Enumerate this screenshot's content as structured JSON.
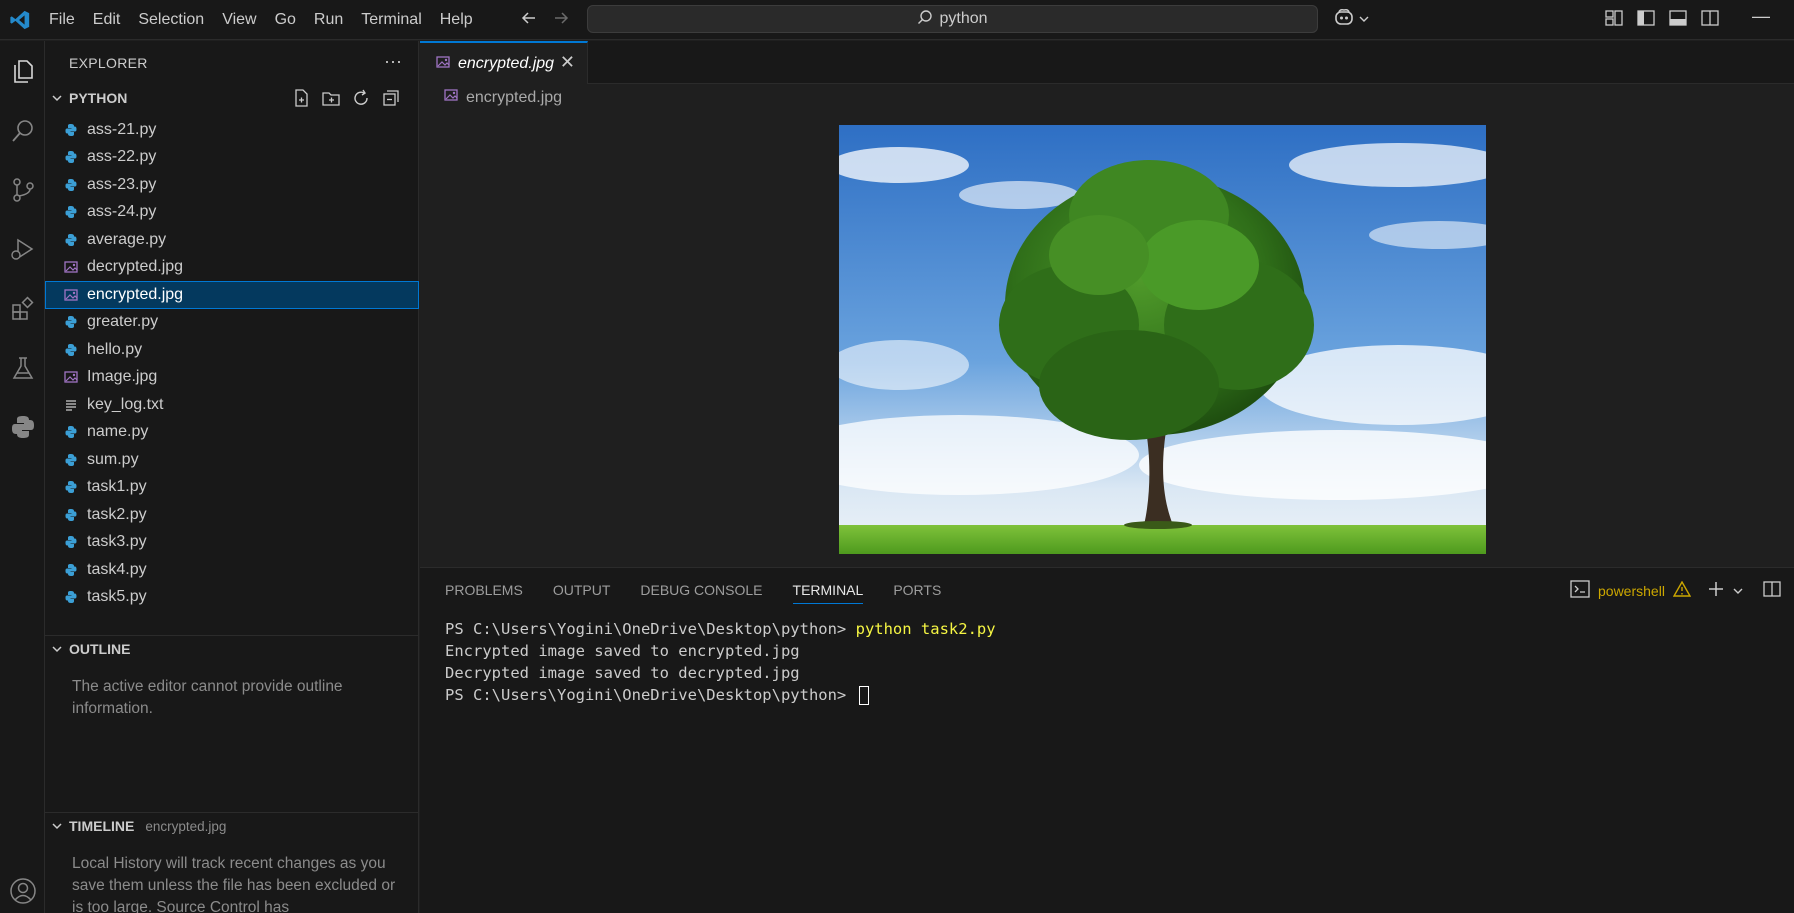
{
  "menu": [
    "File",
    "Edit",
    "Selection",
    "View",
    "Go",
    "Run",
    "Terminal",
    "Help"
  ],
  "search": {
    "value": "python"
  },
  "explorer": {
    "title": "EXPLORER",
    "folder": "PYTHON",
    "files": [
      {
        "name": "ass-21.py",
        "type": "python"
      },
      {
        "name": "ass-22.py",
        "type": "python"
      },
      {
        "name": "ass-23.py",
        "type": "python"
      },
      {
        "name": "ass-24.py",
        "type": "python"
      },
      {
        "name": "average.py",
        "type": "python"
      },
      {
        "name": "decrypted.jpg",
        "type": "image"
      },
      {
        "name": "encrypted.jpg",
        "type": "image",
        "selected": true
      },
      {
        "name": "greater.py",
        "type": "python"
      },
      {
        "name": "hello.py",
        "type": "python"
      },
      {
        "name": "Image.jpg",
        "type": "image"
      },
      {
        "name": "key_log.txt",
        "type": "text"
      },
      {
        "name": "name.py",
        "type": "python"
      },
      {
        "name": "sum.py",
        "type": "python"
      },
      {
        "name": "task1.py",
        "type": "python"
      },
      {
        "name": "task2.py",
        "type": "python"
      },
      {
        "name": "task3.py",
        "type": "python"
      },
      {
        "name": "task4.py",
        "type": "python"
      },
      {
        "name": "task5.py",
        "type": "python"
      }
    ]
  },
  "outline": {
    "title": "OUTLINE",
    "message": "The active editor cannot provide outline information."
  },
  "timeline": {
    "title": "TIMELINE",
    "file": "encrypted.jpg",
    "message": "Local History will track recent changes as you save them unless the file has been excluded or is too large. Source Control has"
  },
  "editor": {
    "tab_label": "encrypted.jpg",
    "breadcrumb": "encrypted.jpg"
  },
  "panel": {
    "tabs": [
      "PROBLEMS",
      "OUTPUT",
      "DEBUG CONSOLE",
      "TERMINAL",
      "PORTS"
    ],
    "active_tab": "TERMINAL",
    "shell": "powershell",
    "terminal": {
      "prompt": "PS C:\\Users\\Yogini\\OneDrive\\Desktop\\python> ",
      "command": "python task2.py",
      "output_1": "Encrypted image saved to encrypted.jpg",
      "output_2": "Decrypted image saved to decrypted.jpg"
    }
  },
  "colors": {
    "accent": "#0078d4",
    "python_icon": "#3b9fd6",
    "image_icon": "#a074c4",
    "warning": "#cca700",
    "command": "#f5f543"
  }
}
